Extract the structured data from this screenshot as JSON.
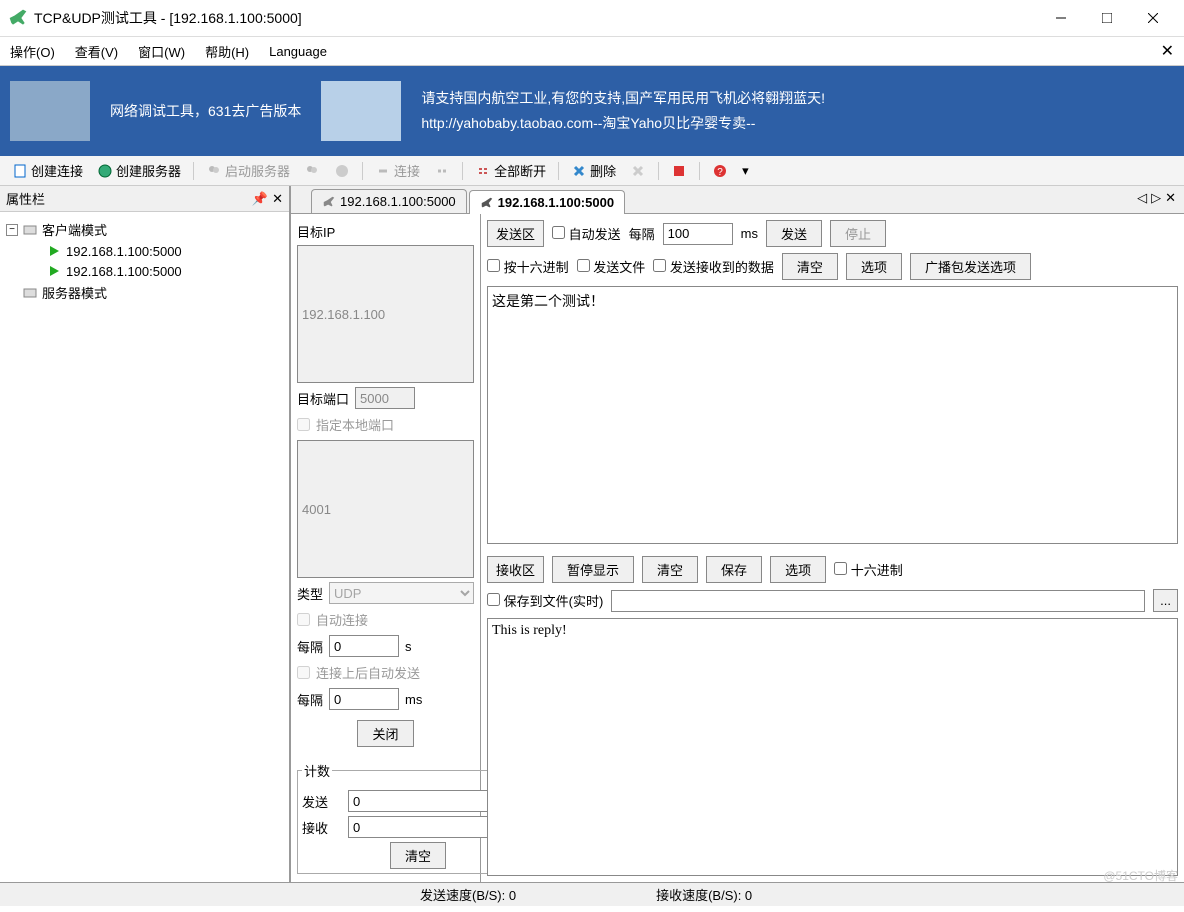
{
  "window": {
    "title": "TCP&UDP测试工具 - [192.168.1.100:5000]"
  },
  "menu": {
    "operate": "操作(O)",
    "view": "查看(V)",
    "window": "窗口(W)",
    "help": "帮助(H)",
    "language": "Language"
  },
  "banner": {
    "text1": "网络调试工具，631去广告版本",
    "line1": "请支持国内航空工业,有您的支持,国产军用民用飞机必将翱翔蓝天!",
    "line2": "http://yahobaby.taobao.com--淘宝Yaho贝比孕婴专卖--"
  },
  "toolbar": {
    "create_conn": "创建连接",
    "create_server": "创建服务器",
    "start_server": "启动服务器",
    "connect": "连接",
    "disconnect_all": "全部断开",
    "delete": "删除"
  },
  "sidebar": {
    "title": "属性栏",
    "client_mode": "客户端模式",
    "server_mode": "服务器模式",
    "conn1": "192.168.1.100:5000",
    "conn2": "192.168.1.100:5000"
  },
  "tabs": {
    "tab1": "192.168.1.100:5000",
    "tab2": "192.168.1.100:5000"
  },
  "left": {
    "target_ip_label": "目标IP",
    "target_ip": "192.168.1.100",
    "target_port_label": "目标端口",
    "target_port": "5000",
    "local_port_label": "指定本地端口",
    "local_port": "4001",
    "type_label": "类型",
    "type": "UDP",
    "auto_connect": "自动连接",
    "interval_label": "每隔",
    "interval_s": "0",
    "unit_s": "s",
    "auto_send_after": "连接上后自动发送",
    "interval_ms": "0",
    "unit_ms": "ms",
    "close_btn": "关闭",
    "counter_title": "计数",
    "send_label": "发送",
    "send_count": "0",
    "recv_label": "接收",
    "recv_count": "0",
    "clear_btn": "清空"
  },
  "send": {
    "area_label": "发送区",
    "auto_send": "自动发送",
    "interval_label": "每隔",
    "interval": "100",
    "unit": "ms",
    "send_btn": "发送",
    "stop_btn": "停止",
    "hex": "按十六进制",
    "send_file": "发送文件",
    "send_recv_data": "发送接收到的数据",
    "clear_btn": "清空",
    "option_btn": "选项",
    "broadcast_btn": "广播包发送选项",
    "content": "这是第二个测试！"
  },
  "recv": {
    "area_label": "接收区",
    "pause_btn": "暂停显示",
    "clear_btn": "清空",
    "save_btn": "保存",
    "option_btn": "选项",
    "hex": "十六进制",
    "save_file": "保存到文件(实时)",
    "browse": "...",
    "content": "This is reply!"
  },
  "status": {
    "send_speed": "发送速度(B/S): 0",
    "recv_speed": "接收速度(B/S): 0"
  },
  "watermark": "@51CTO博客"
}
